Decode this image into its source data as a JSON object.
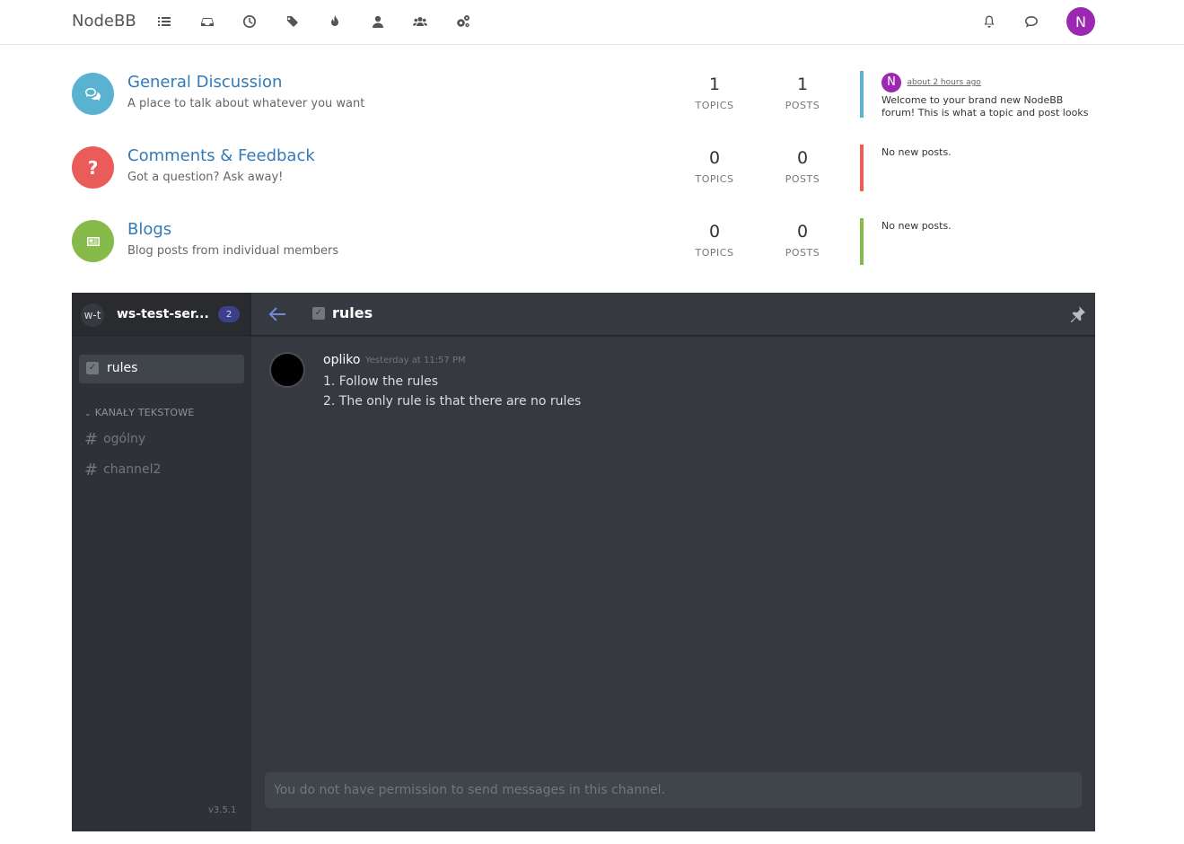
{
  "nav": {
    "brand": "NodeBB",
    "icons": [
      "categories-icon",
      "unread-icon",
      "recent-icon",
      "tags-icon",
      "popular-icon",
      "users-icon",
      "groups-icon",
      "admin-icon"
    ],
    "user_initial": "N"
  },
  "categories": [
    {
      "title": "General Discussion",
      "description": "A place to talk about whatever you want",
      "topics": "1",
      "posts": "1",
      "topics_label": "TOPICS",
      "posts_label": "POSTS",
      "color": "#59b3d0",
      "teaser": {
        "avatar": "N",
        "time": "about 2 hours ago",
        "text": "Welcome to your brand new NodeBB forum! This is what a topic and post looks like. As an"
      }
    },
    {
      "title": "Comments & Feedback",
      "description": "Got a question? Ask away!",
      "topics": "0",
      "posts": "0",
      "topics_label": "TOPICS",
      "posts_label": "POSTS",
      "color": "#e95c5a",
      "teaser": {
        "text": "No new posts."
      }
    },
    {
      "title": "Blogs",
      "description": "Blog posts from individual members",
      "topics": "0",
      "posts": "0",
      "topics_label": "TOPICS",
      "posts_label": "POSTS",
      "color": "#86ba4b",
      "teaser": {
        "text": "No new posts."
      }
    }
  ],
  "widget": {
    "server_initials": "w-t",
    "server_name": "ws-test-ser...",
    "badge": "2",
    "active_channel": "rules",
    "category": "KANAŁY TEKSTOWE",
    "channels": [
      "ogólny",
      "channel2"
    ],
    "version": "v3.5.1",
    "header_title": "rules",
    "message": {
      "author": "opliko",
      "time": "Yesterday at 11:57 PM",
      "lines": [
        "1. Follow the rules",
        "2. The only rule is that there are no rules"
      ]
    },
    "input_placeholder": "You do not have permission to send messages in this channel."
  }
}
